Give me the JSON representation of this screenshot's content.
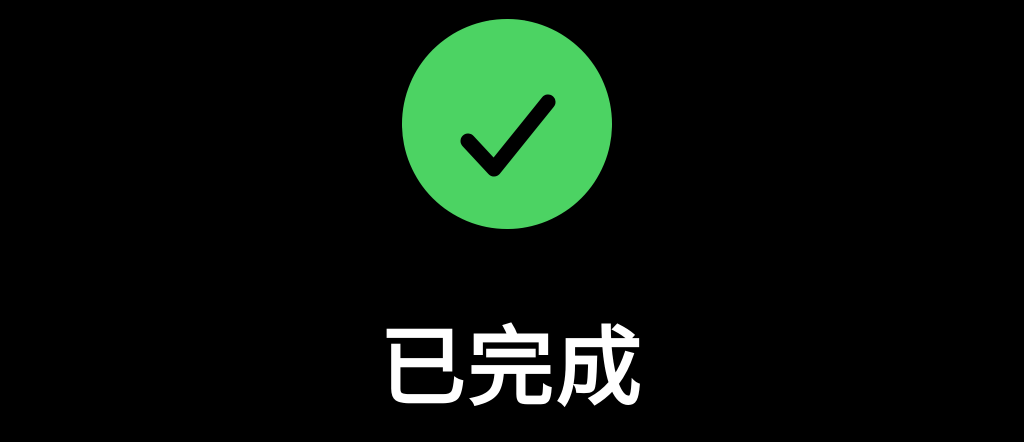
{
  "completion": {
    "status_text": "已完成",
    "icon": "check-circle-icon",
    "icon_color": "#4cd363",
    "check_color": "#000000",
    "background": "#000000",
    "text_color": "#ffffff"
  }
}
